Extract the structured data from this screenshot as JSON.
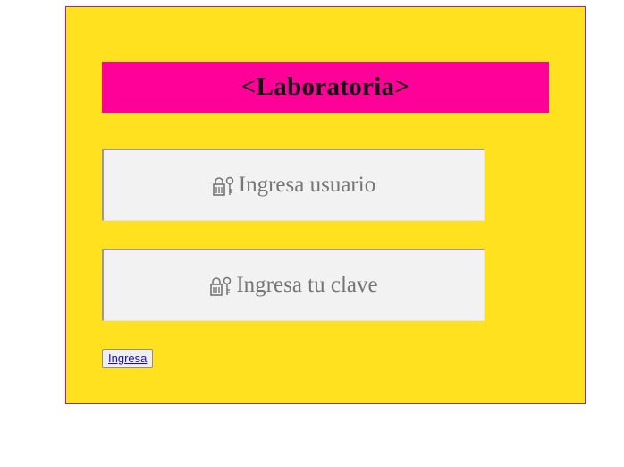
{
  "header": {
    "title": "<Laboratoria>"
  },
  "form": {
    "username_placeholder": "Ingresa usuario",
    "password_placeholder": "Ingresa tu clave",
    "username_icon": "lock-key-icon",
    "password_icon": "lock-key-icon",
    "submit_label": "Ingresa"
  },
  "colors": {
    "background": "#ffe11f",
    "title_bar": "#ff0099",
    "frame_border": "#c0159e",
    "field_background": "#f2f2f2",
    "link_text": "#1a0dab"
  }
}
